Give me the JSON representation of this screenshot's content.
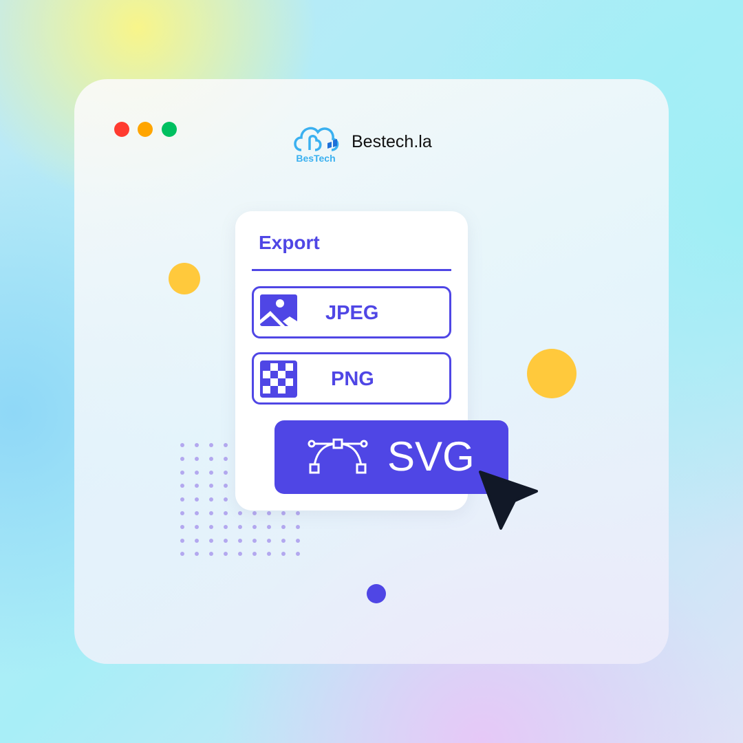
{
  "window": {
    "traffic_lights": [
      "#ff3b30",
      "#ffa500",
      "#00c060"
    ]
  },
  "header": {
    "logo_text": "BesTech",
    "brand": "Bestech.la"
  },
  "export_panel": {
    "title": "Export",
    "options": [
      {
        "label": "JPEG",
        "icon": "image-icon"
      },
      {
        "label": "PNG",
        "icon": "checkerboard-icon"
      }
    ],
    "selected": {
      "label": "SVG",
      "icon": "bezier-curve-icon"
    }
  },
  "colors": {
    "accent": "#4f46e5",
    "yellow": "#ffc93c",
    "cursor": "#111827"
  }
}
